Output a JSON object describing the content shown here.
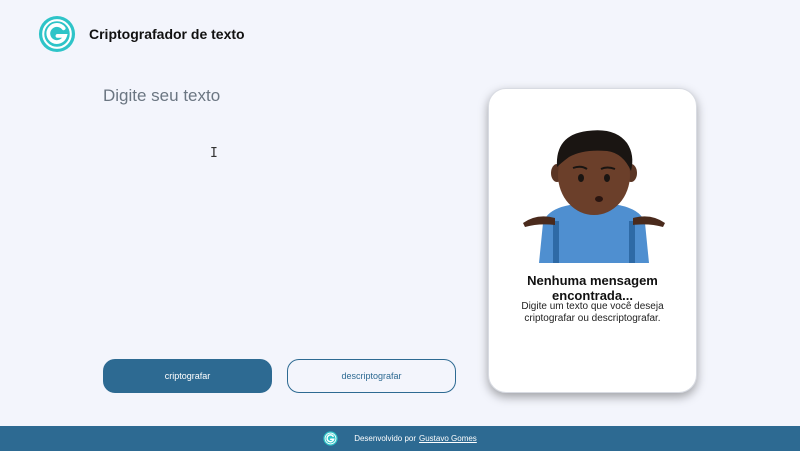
{
  "header": {
    "title": "Criptografador de texto",
    "logo_icon": "g-logo-icon"
  },
  "input": {
    "placeholder": "Digite seu texto",
    "value": ""
  },
  "buttons": {
    "encrypt_label": "criptografar",
    "decrypt_label": "descriptografar"
  },
  "result_card": {
    "title": "Nenhuma mensagem encontrada...",
    "text": "Digite um texto que você deseja criptografar ou descriptografar.",
    "illustration_icon": "person-shrugging-icon"
  },
  "footer": {
    "prefix": "Desenvolvido por",
    "author_link": "Gustavo Gomes"
  },
  "colors": {
    "accent": "#2d6a92",
    "background": "#f3f5fc",
    "logo": "#2ec4c8"
  }
}
